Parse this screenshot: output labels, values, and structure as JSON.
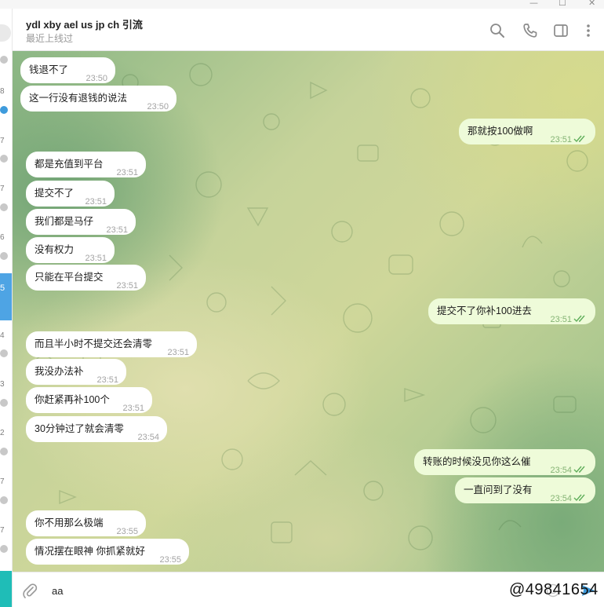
{
  "window": {
    "minimize_glyph": "—",
    "maximize_glyph": "☐",
    "close_glyph": "✕"
  },
  "sidebar": {
    "counts": [
      "8",
      "7",
      "7",
      "6",
      "4",
      "3",
      "2",
      "7",
      "7"
    ],
    "active_count": "5"
  },
  "header": {
    "title": "ydl xby ael us jp ch 引流",
    "status": "最近上线过",
    "icons": [
      "search-icon",
      "phone-icon",
      "sidebar-toggle-icon",
      "more-icon"
    ]
  },
  "messages": [
    {
      "dir": "in",
      "text": "钱退不了",
      "time": "23:50"
    },
    {
      "dir": "in",
      "text": "这一行没有退钱的说法",
      "time": "23:50"
    },
    {
      "dir": "out",
      "text": "那就按100做啊",
      "time": "23:51"
    },
    {
      "dir": "in",
      "text": "都是充值到平台",
      "time": "23:51"
    },
    {
      "dir": "in",
      "text": "提交不了",
      "time": "23:51"
    },
    {
      "dir": "in",
      "text": "我们都是马仔",
      "time": "23:51"
    },
    {
      "dir": "in",
      "text": "没有权力",
      "time": "23:51"
    },
    {
      "dir": "in",
      "text": "只能在平台提交",
      "time": "23:51"
    },
    {
      "dir": "out",
      "text": "提交不了你补100进去",
      "time": "23:51"
    },
    {
      "dir": "in",
      "text": "而且半小时不提交还会清零",
      "time": "23:51"
    },
    {
      "dir": "in",
      "text": "我没办法补",
      "time": "23:51"
    },
    {
      "dir": "in",
      "text": "你赶紧再补100个",
      "time": "23:51"
    },
    {
      "dir": "in",
      "text": "30分钟过了就会清零",
      "time": "23:54"
    },
    {
      "dir": "out",
      "text": "转账的时候没见你这么催",
      "time": "23:54"
    },
    {
      "dir": "out",
      "text": "一直问到了没有",
      "time": "23:54"
    },
    {
      "dir": "in",
      "text": "你不用那么极端",
      "time": "23:55"
    },
    {
      "dir": "in",
      "text": "情况摆在眼神 你抓紧就好",
      "time": "23:55"
    }
  ],
  "composer": {
    "value": "aa",
    "overlay_text": "@49841654"
  },
  "colors": {
    "incoming_bubble": "#ffffff",
    "outgoing_bubble": "#eefbd9",
    "tick_color": "#5fae5a",
    "send_color": "#3e9bdc",
    "active_chat": "#4ea4e4"
  }
}
